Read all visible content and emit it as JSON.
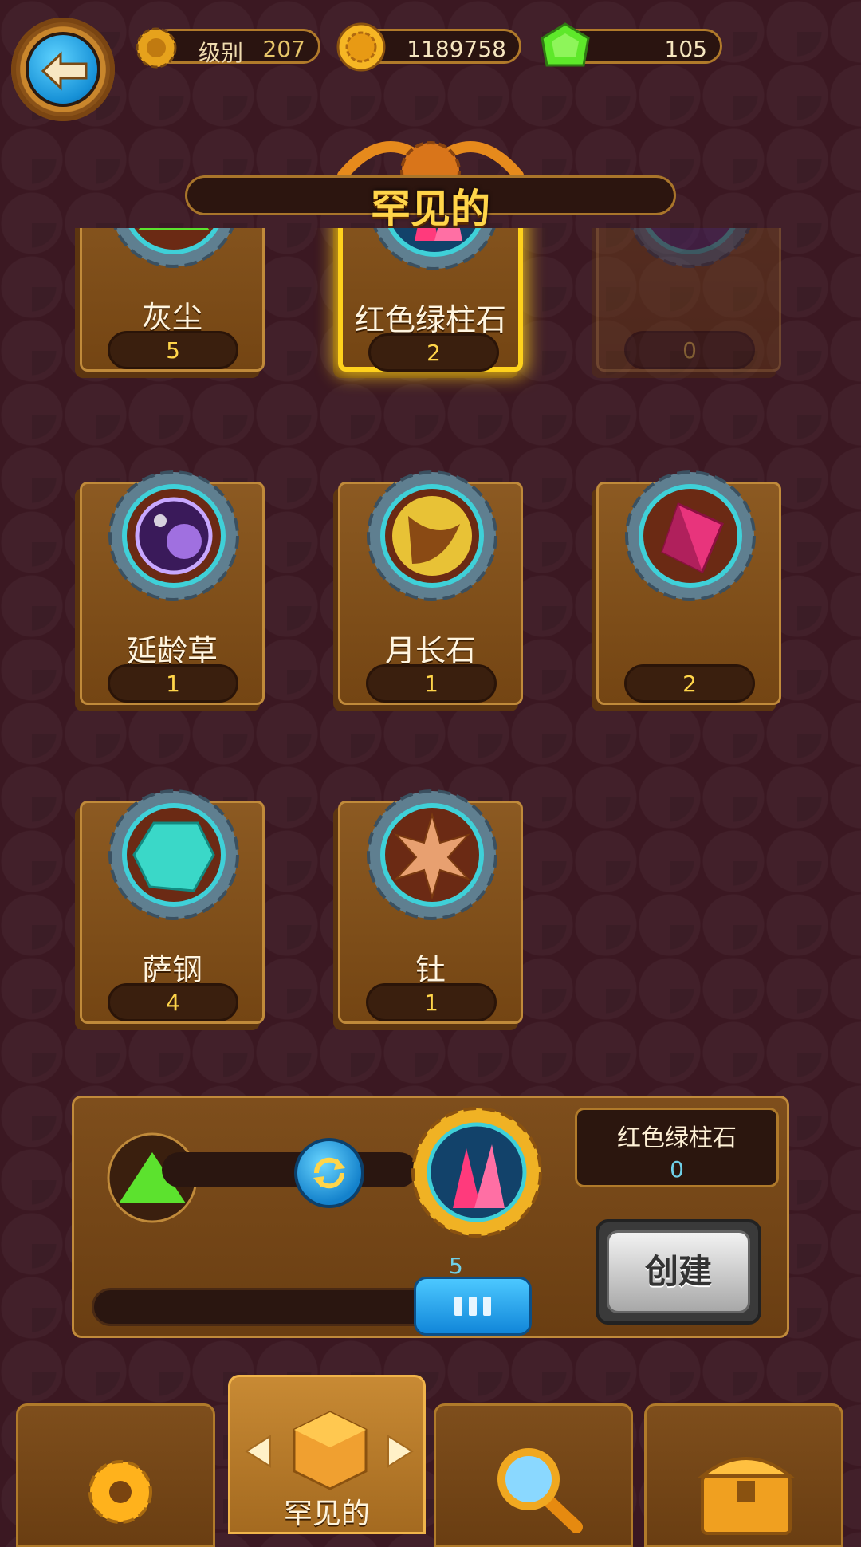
{
  "hud": {
    "level_label": "级别",
    "level_value": "207",
    "coins": "1189758",
    "gems": "105"
  },
  "title": "罕见的",
  "cards": [
    {
      "name": "灰尘",
      "count": "5",
      "icon": "green-dust-icon",
      "state": "normal"
    },
    {
      "name": "红色绿柱石",
      "count": "2",
      "icon": "red-crystal-icon",
      "state": "selected"
    },
    {
      "name": "",
      "count": "0",
      "icon": "purple-stone-icon",
      "state": "dimmed"
    },
    {
      "name": "延龄草",
      "count": "1",
      "icon": "purple-orb-icon",
      "state": "normal"
    },
    {
      "name": "月长石",
      "count": "1",
      "icon": "moonstone-icon",
      "state": "normal"
    },
    {
      "name": "",
      "count": "2",
      "icon": "pink-gem-icon",
      "state": "normal"
    },
    {
      "name": "萨钢",
      "count": "4",
      "icon": "cyan-ore-icon",
      "state": "normal"
    },
    {
      "name": "钍",
      "count": "1",
      "icon": "spiky-burst-icon",
      "state": "normal"
    }
  ],
  "craft": {
    "target_name": "红色绿柱石",
    "target_owned": "0",
    "amount": "5",
    "slider_fraction": 0.72,
    "create_label": "创建"
  },
  "nav": {
    "active_tab_label": "罕见的"
  }
}
